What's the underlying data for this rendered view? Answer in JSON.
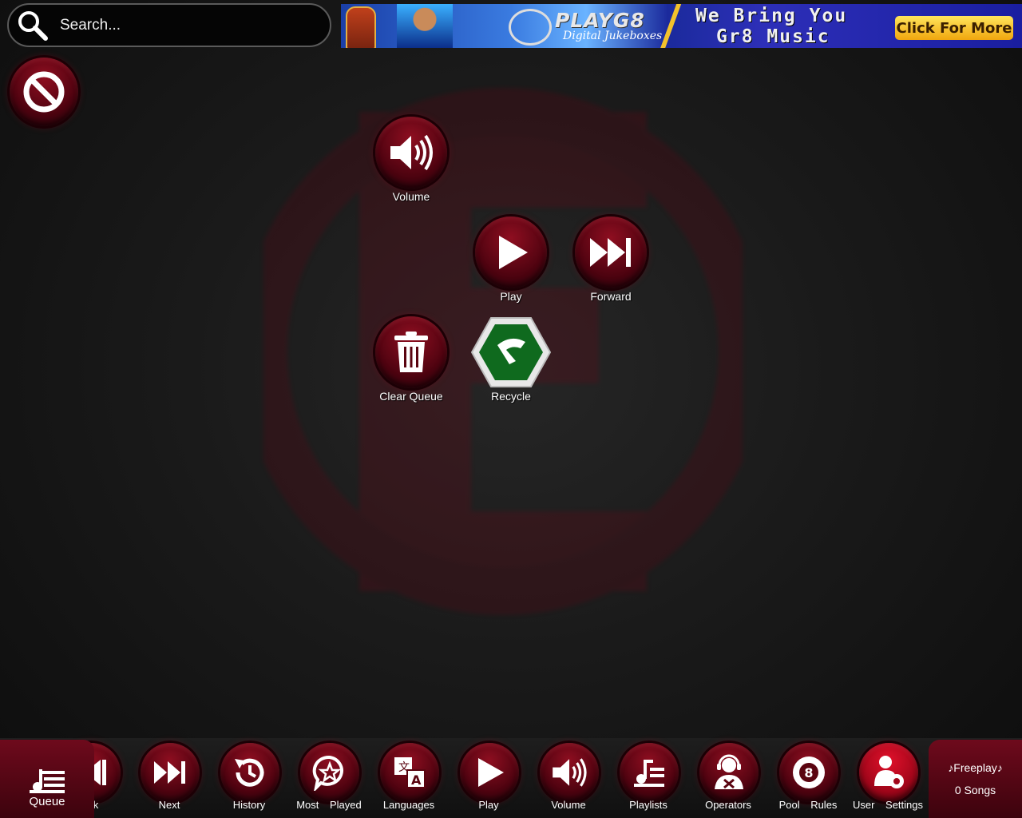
{
  "search": {
    "placeholder": "Search..."
  },
  "banner": {
    "brand": "PLAYG8",
    "brand_sub": "Digital Jukeboxes",
    "tagline_line1": "We Bring You",
    "tagline_line2": "Gr8 Music",
    "cta": "Click For More"
  },
  "controls": {
    "volume": "Volume",
    "play": "Play",
    "forward": "Forward",
    "clear_queue": "Clear Queue",
    "recycle": "Recycle"
  },
  "bottom_nav": {
    "queue": "Queue",
    "back": "k",
    "next": "Next",
    "history": "History",
    "most_played": "Most Played",
    "languages": "Languages",
    "play": "Play",
    "volume": "Volume",
    "playlists": "Playlists",
    "operators": "Operators",
    "pool_rules": "Pool Rules",
    "user_settings": "User Settings"
  },
  "status": {
    "freeplay": "♪Freeplay♪",
    "songs": "0 Songs"
  },
  "colors": {
    "accent": "#8e0e20",
    "background": "#1a1a1a",
    "recycle_green": "#0f6a1e"
  }
}
